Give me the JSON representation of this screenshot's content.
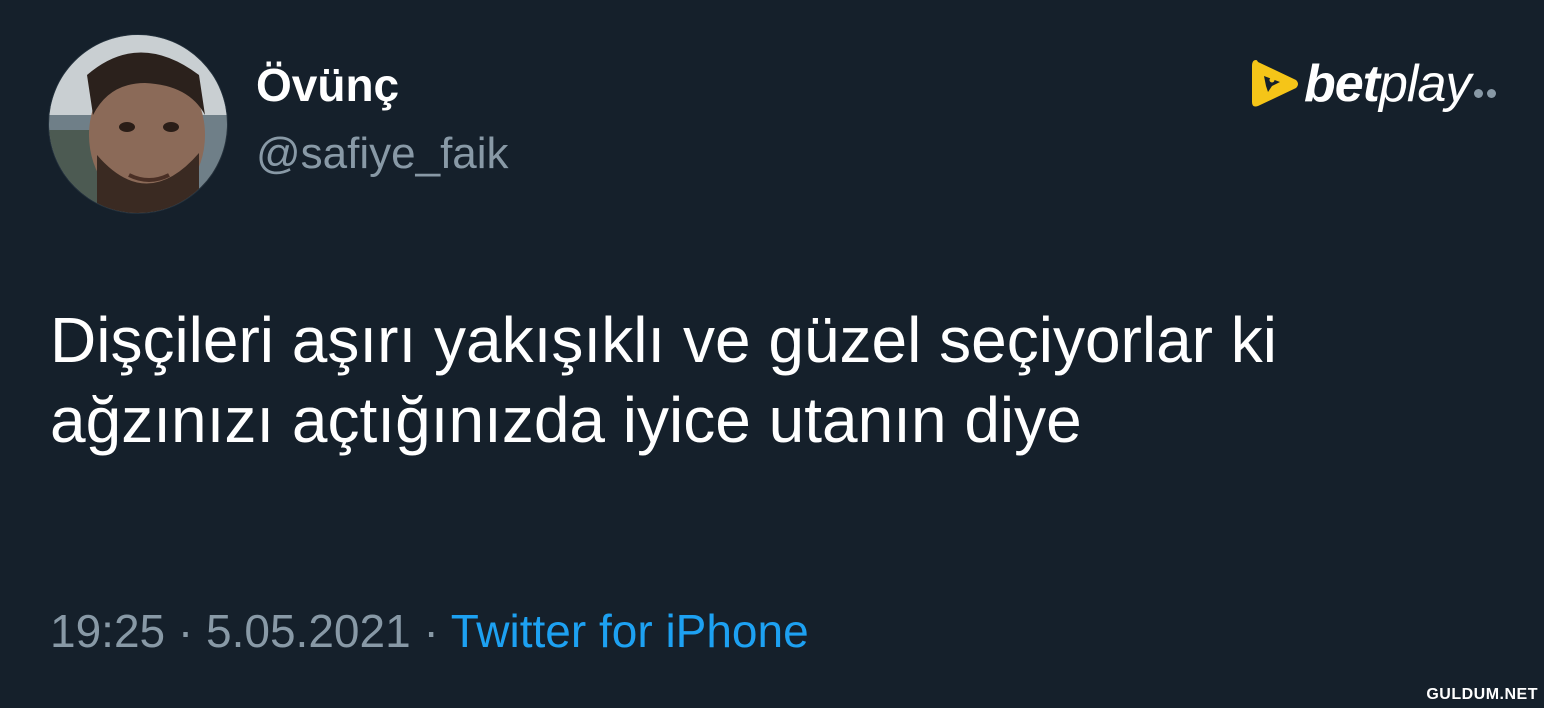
{
  "tweet": {
    "author": {
      "name": "Övünç",
      "handle": "@safiye_faik"
    },
    "text_lines": [
      "Dişçileri aşırı yakışıklı ve güzel seçiyorlar ki",
      "ağzınızı açtığınızda iyice utanın diye"
    ],
    "time": "19:25",
    "separator": "·",
    "date": "5.05.2021",
    "source": "Twitter for iPhone"
  },
  "watermark": {
    "brand_bold": "bet",
    "brand_light": "play"
  },
  "site": {
    "label": "GULDUM.NET"
  },
  "colors": {
    "background": "#15202b",
    "text_primary": "#ffffff",
    "text_secondary": "#8899a6",
    "link": "#1da1f2",
    "brand_yellow": "#f5c518"
  },
  "icons": {
    "logo": "play-rocket-icon"
  }
}
